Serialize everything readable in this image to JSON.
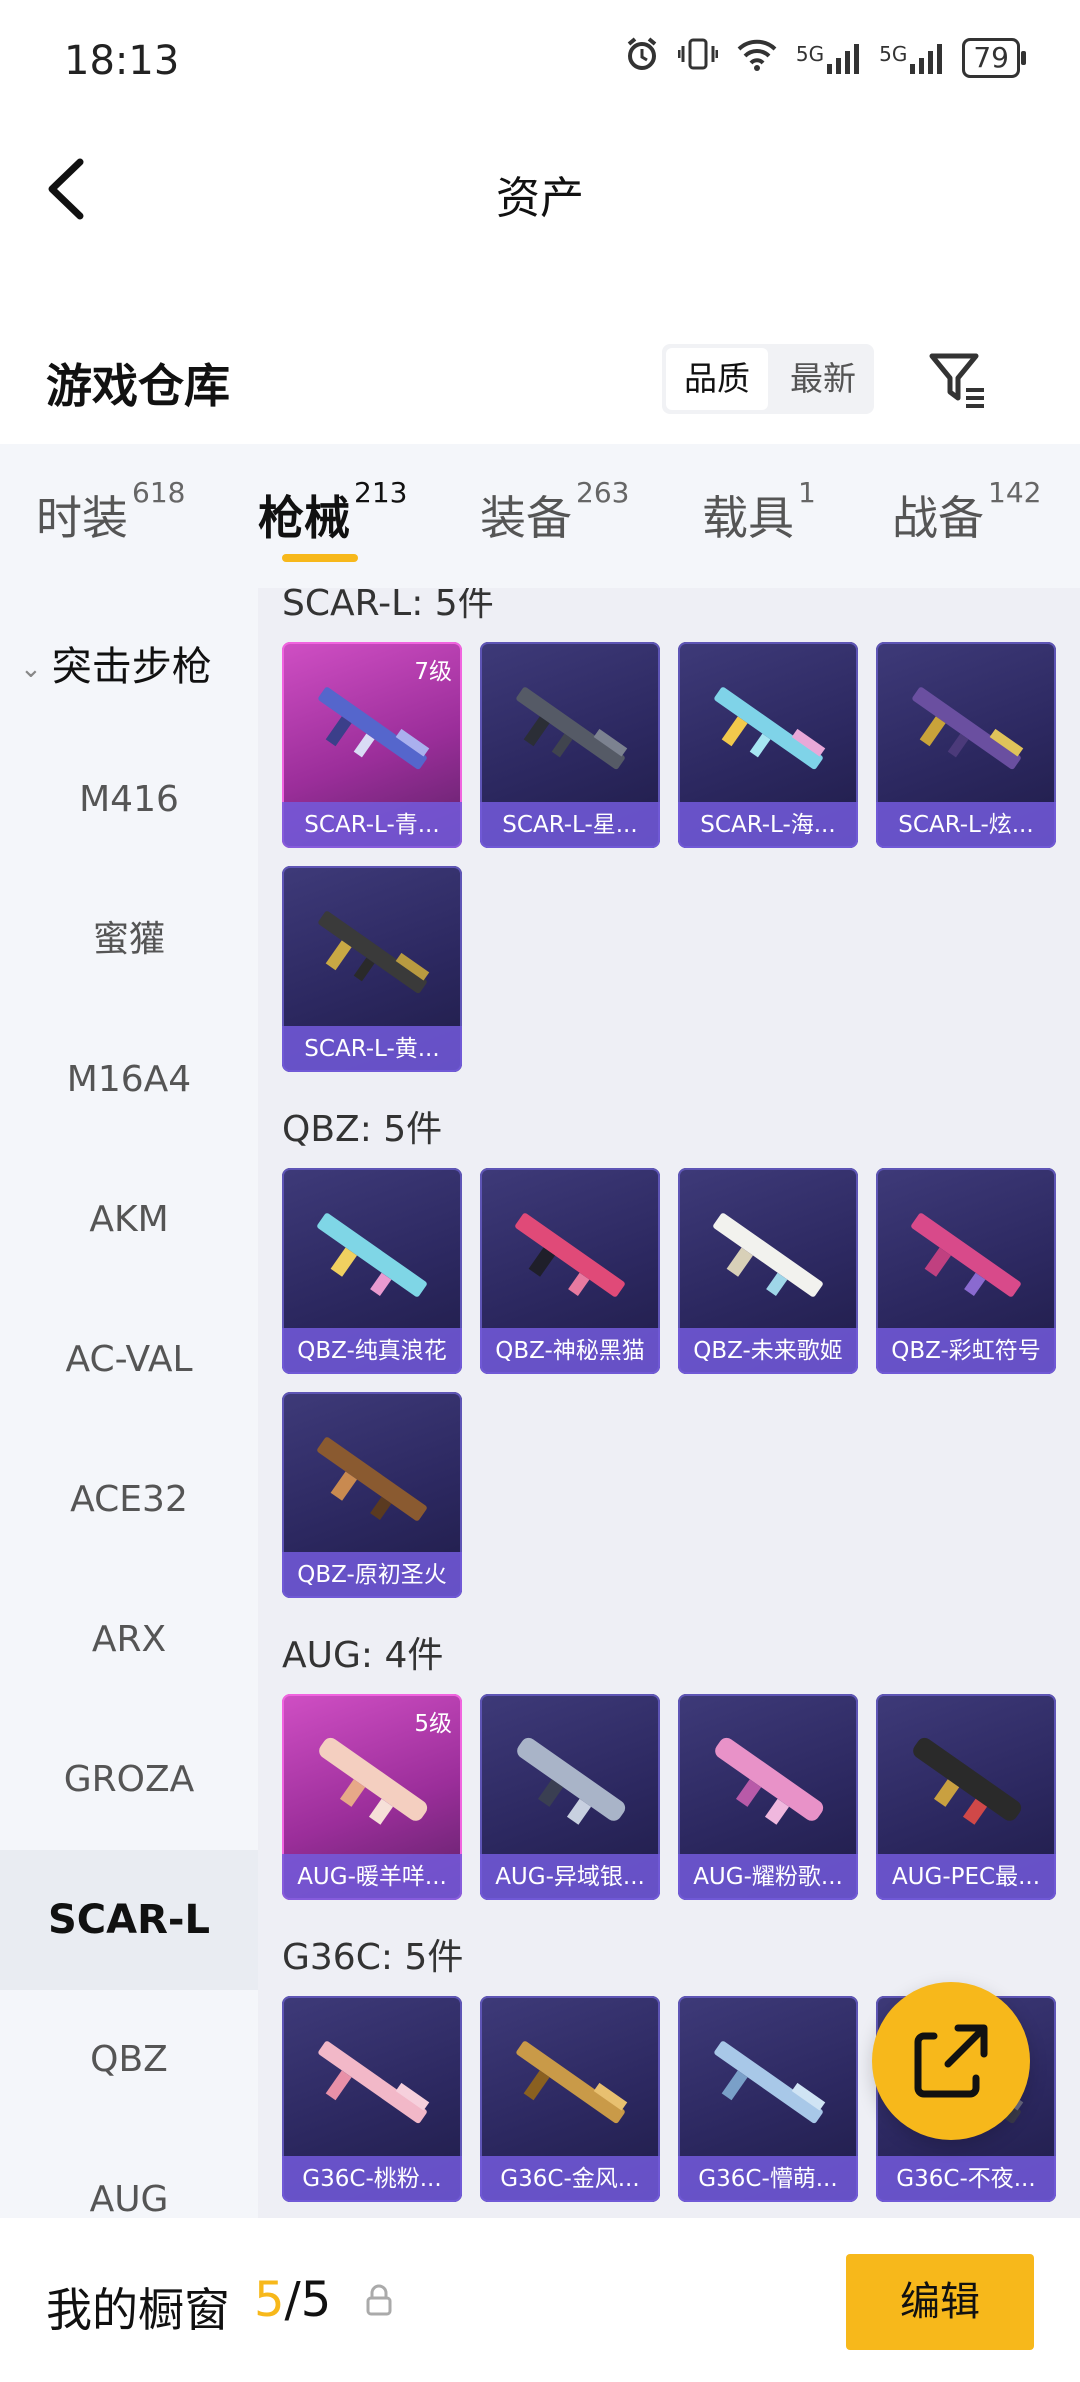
{
  "status_bar": {
    "time": "18:13",
    "signal_1": "5G",
    "signal_2": "5G",
    "battery": "79"
  },
  "header": {
    "title": "资产",
    "back_icon": "chevron-left-icon"
  },
  "warehouse": {
    "title": "游戏仓库",
    "sort_options": [
      "品质",
      "最新"
    ],
    "sort_selected": "品质",
    "filter_icon": "filter-icon"
  },
  "tabs": [
    {
      "label": "时装",
      "count": "618"
    },
    {
      "label": "枪械",
      "count": "213",
      "active": true
    },
    {
      "label": "装备",
      "count": "263"
    },
    {
      "label": "载具",
      "count": "1"
    },
    {
      "label": "战备",
      "count": "142"
    }
  ],
  "sidebar": {
    "category": "突击步枪",
    "items": [
      "M416",
      "蜜獾",
      "M16A4",
      "AKM",
      "AC-VAL",
      "ACE32",
      "ARX",
      "GROZA",
      "SCAR-L",
      "QBZ",
      "AUG"
    ],
    "active": "SCAR-L"
  },
  "sections": [
    {
      "title": "SCAR-L: 5件",
      "items": [
        {
          "name": "SCAR-L-青...",
          "level": "7级",
          "rarity": "pink"
        },
        {
          "name": "SCAR-L-星...",
          "rarity": "purple"
        },
        {
          "name": "SCAR-L-海...",
          "rarity": "purple"
        },
        {
          "name": "SCAR-L-炫...",
          "rarity": "purple"
        },
        {
          "name": "SCAR-L-黄...",
          "rarity": "purple"
        }
      ]
    },
    {
      "title": "QBZ: 5件",
      "items": [
        {
          "name": "QBZ-纯真浪花",
          "rarity": "purple"
        },
        {
          "name": "QBZ-神秘黑猫",
          "rarity": "purple"
        },
        {
          "name": "QBZ-未来歌姬",
          "rarity": "purple"
        },
        {
          "name": "QBZ-彩虹符号",
          "rarity": "purple"
        },
        {
          "name": "QBZ-原初圣火",
          "rarity": "purple"
        }
      ]
    },
    {
      "title": "AUG: 4件",
      "items": [
        {
          "name": "AUG-暖羊咩...",
          "level": "5级",
          "rarity": "pink"
        },
        {
          "name": "AUG-异域银...",
          "rarity": "purple"
        },
        {
          "name": "AUG-耀粉歌...",
          "rarity": "purple"
        },
        {
          "name": "AUG-PEC最...",
          "rarity": "purple"
        }
      ]
    },
    {
      "title": "G36C: 5件",
      "items": [
        {
          "name": "G36C-桃粉...",
          "rarity": "purple"
        },
        {
          "name": "G36C-金风...",
          "rarity": "purple"
        },
        {
          "name": "G36C-懵萌...",
          "rarity": "purple"
        },
        {
          "name": "G36C-不夜...",
          "rarity": "purple"
        }
      ]
    }
  ],
  "fab": {
    "icon": "share-icon"
  },
  "bottom_bar": {
    "title": "我的橱窗",
    "current": "5",
    "separator": "/",
    "total": "5",
    "lock_icon": "lock-icon",
    "edit_label": "编辑"
  },
  "colors": {
    "accent": "#f7b81b",
    "card_purple": "#2c2860",
    "card_pink": "#b03ab0",
    "label_bar": "#735adc"
  }
}
